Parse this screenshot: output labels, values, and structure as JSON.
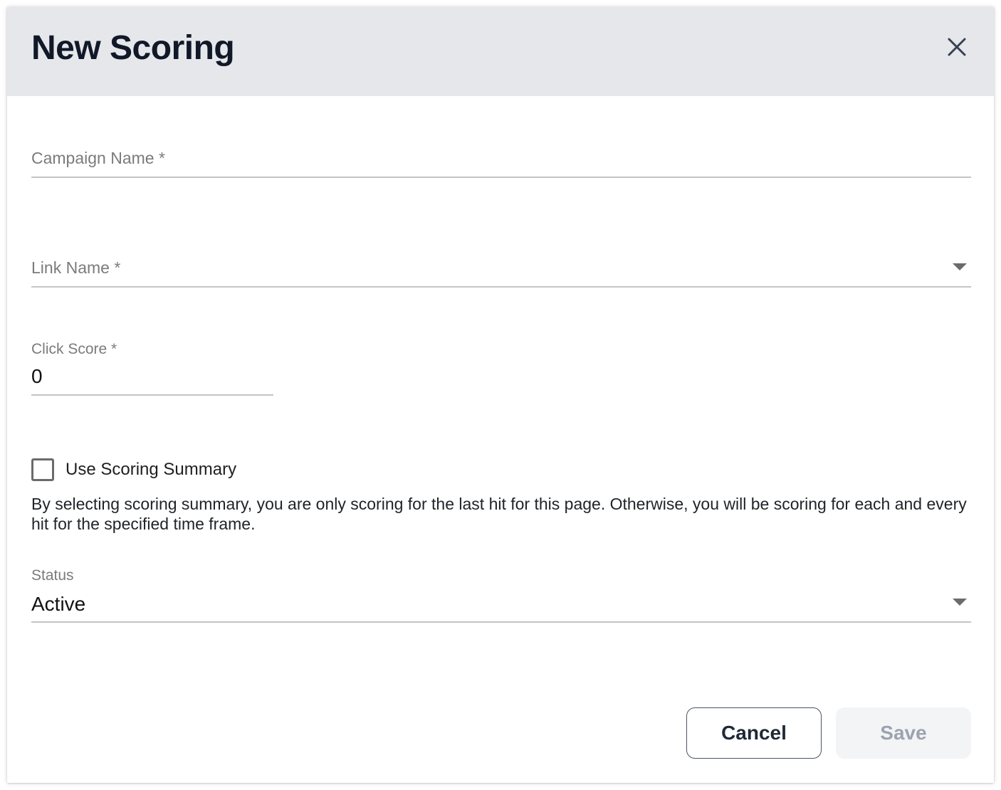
{
  "dialog": {
    "title": "New Scoring"
  },
  "fields": {
    "campaign_name": {
      "label": "Campaign Name *",
      "value": ""
    },
    "link_name": {
      "label": "Link Name *",
      "value": ""
    },
    "click_score": {
      "label": "Click Score *",
      "value": "0"
    },
    "use_scoring_summary": {
      "label": "Use Scoring Summary",
      "checked": false
    },
    "help_text": "By selecting scoring summary, you are only scoring for the last hit for this page. Otherwise, you will be scoring for each and every hit for the specified time frame.",
    "status": {
      "label": "Status",
      "value": "Active"
    }
  },
  "actions": {
    "cancel_label": "Cancel",
    "save_label": "Save"
  },
  "icons": {
    "close": "close-icon",
    "dropdown": "chevron-down-icon",
    "checkbox": "checkbox-unchecked-icon"
  },
  "colors": {
    "header_bg": "#e5e7eb",
    "title_text": "#111827",
    "disabled_button_bg": "#f3f4f6",
    "disabled_button_text": "#9ca3af"
  }
}
